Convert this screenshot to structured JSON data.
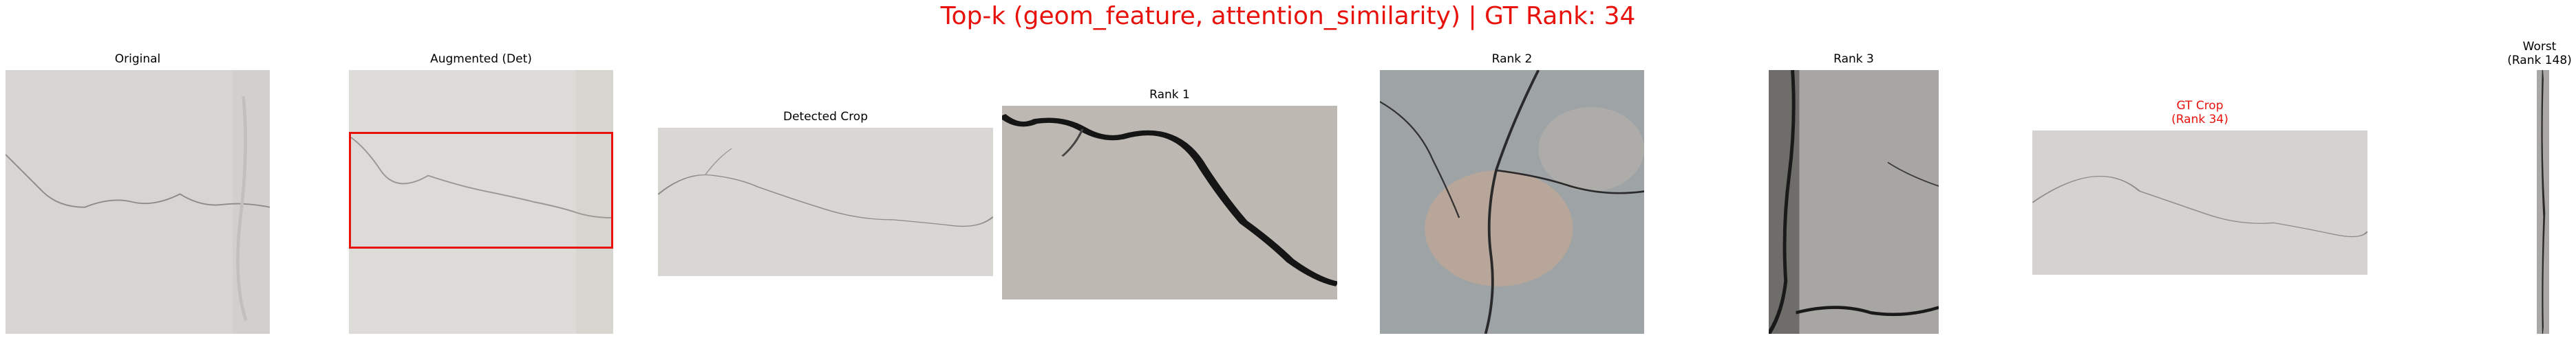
{
  "figure": {
    "title": "Top-k (geom_feature, attention_similarity) | GT Rank: 34",
    "title_color": "#e8120c"
  },
  "panels": {
    "original": {
      "title": "Original",
      "image": "concrete-hairline-crack"
    },
    "augmented": {
      "title": "Augmented (Det)",
      "image": "concrete-hairline-crack",
      "box_color": "#e8120c"
    },
    "detected": {
      "title": "Detected Crop",
      "image": "concrete-crack-crop"
    },
    "rank1": {
      "title": "Rank 1",
      "image": "wide-dark-crack"
    },
    "rank2": {
      "title": "Rank 2",
      "image": "weathered-stone-crack"
    },
    "rank3": {
      "title": "Rank 3",
      "image": "concrete-wall-crack"
    },
    "gt": {
      "title": "GT Crop\n(Rank 34)",
      "title_color": "#e8120c",
      "image": "concrete-crack-crop"
    },
    "worst": {
      "title": "Worst\n(Rank 148)",
      "image": "thin-strip-crack"
    }
  }
}
